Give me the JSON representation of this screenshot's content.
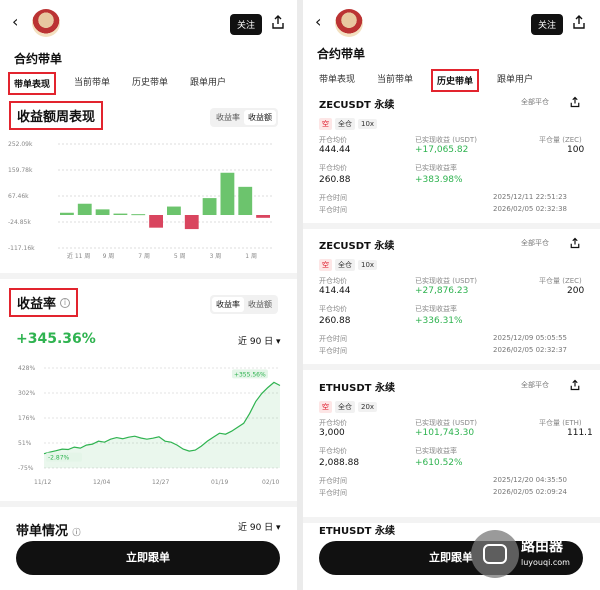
{
  "left": {
    "back_icon": "chevron-left-icon",
    "follow_label": "关注",
    "page_title": "合约带单",
    "tabs": [
      "带单表现",
      "当前带单",
      "历史带单",
      "跟单用户"
    ],
    "weekly_title": "收益额周表现",
    "weekly_toggle": [
      "收益率",
      "收益额"
    ],
    "weekly_toggle_active": 1,
    "roi_title": "收益率",
    "roi_toggle": [
      "收益率",
      "收益额"
    ],
    "roi_value": "+345.36%",
    "period": "近 90 日",
    "stats_title": "带单情况",
    "stats_period": "近 90 日",
    "cta": "立即跟单"
  },
  "bar_chart": {
    "type": "bar",
    "y_ticks": [
      "252.09k",
      "159.78k",
      "67.46k",
      "-24.85k",
      "-117.16k"
    ],
    "x_labels": [
      "近 11 周",
      "9 周",
      "7 周",
      "5 周",
      "3 周",
      "1 周"
    ],
    "values": [
      8,
      40,
      20,
      5,
      3,
      -45,
      30,
      -50,
      60,
      150,
      100,
      -10
    ],
    "ylim": [
      -117.16,
      252.09
    ],
    "colors": {
      "pos": "#6cc46d",
      "neg": "#d9455f"
    }
  },
  "line_chart": {
    "type": "line",
    "y_ticks": [
      "428%",
      "302%",
      "176%",
      "51%",
      "-75%"
    ],
    "x_labels": [
      "11/12",
      "12/04",
      "12/27",
      "01/19",
      "02/10"
    ],
    "min_label": "-2.87%",
    "max_label": "+355.56%",
    "values": [
      -2.87,
      5,
      12,
      20,
      18,
      30,
      25,
      40,
      45,
      60,
      55,
      70,
      78,
      72,
      80,
      85,
      76,
      70,
      75,
      82,
      60,
      55,
      40,
      20,
      10,
      15,
      35,
      60,
      80,
      100,
      95,
      110,
      130,
      150,
      200,
      260,
      300,
      330,
      355.56,
      340
    ],
    "ylim": [
      -75,
      428
    ],
    "color": "#2fb350"
  },
  "right": {
    "back_icon": "chevron-left-icon",
    "follow_label": "关注",
    "page_title": "合约带单",
    "tabs": [
      "带单表现",
      "当前带单",
      "历史带单",
      "跟单用户"
    ],
    "cta": "立即跟单",
    "watermark_text": "路由器",
    "watermark_url": "luyouqi.com",
    "cards": [
      {
        "symbol": "ZECUSDT 永续",
        "all": "全部平仓",
        "badges": [
          "空",
          "全仓",
          "10x"
        ],
        "open_label": "开仓均价",
        "open_value": "444.44",
        "pnl_label": "已实现收益 (USDT)",
        "pnl_value": "+17,065.82",
        "qty_label": "平仓量 (ZEC)",
        "qty_value": "100",
        "close_label": "平仓均价",
        "close_value": "260.88",
        "roi_label": "已实现收益率",
        "roi_value": "+383.98%",
        "open_time_label": "开仓时间",
        "open_time": "2025/12/11 22:51:23",
        "close_time_label": "平仓时间",
        "close_time": "2026/02/05 02:32:38"
      },
      {
        "symbol": "ZECUSDT 永续",
        "all": "全部平仓",
        "badges": [
          "空",
          "全仓",
          "10x"
        ],
        "open_label": "开仓均价",
        "open_value": "414.44",
        "pnl_label": "已实现收益 (USDT)",
        "pnl_value": "+27,876.23",
        "qty_label": "平仓量 (ZEC)",
        "qty_value": "200",
        "close_label": "平仓均价",
        "close_value": "260.88",
        "roi_label": "已实现收益率",
        "roi_value": "+336.31%",
        "open_time_label": "开仓时间",
        "open_time": "2025/12/09 05:05:55",
        "close_time_label": "平仓时间",
        "close_time": "2026/02/05 02:32:37"
      },
      {
        "symbol": "ETHUSDT 永续",
        "all": "全部平仓",
        "badges": [
          "空",
          "全仓",
          "20x"
        ],
        "open_label": "开仓均价",
        "open_value": "3,000",
        "pnl_label": "已实现收益 (USDT)",
        "pnl_value": "+101,743.30",
        "qty_label": "平仓量 (ETH)",
        "qty_value": "111.1",
        "close_label": "平仓均价",
        "close_value": "2,088.88",
        "roi_label": "已实现收益率",
        "roi_value": "+610.52%",
        "open_time_label": "开仓时间",
        "open_time": "2025/12/20 04:35:50",
        "close_time_label": "平仓时间",
        "close_time": "2026/02/05 02:09:24"
      }
    ],
    "partial_symbol": "ETHUSDT 永续"
  }
}
